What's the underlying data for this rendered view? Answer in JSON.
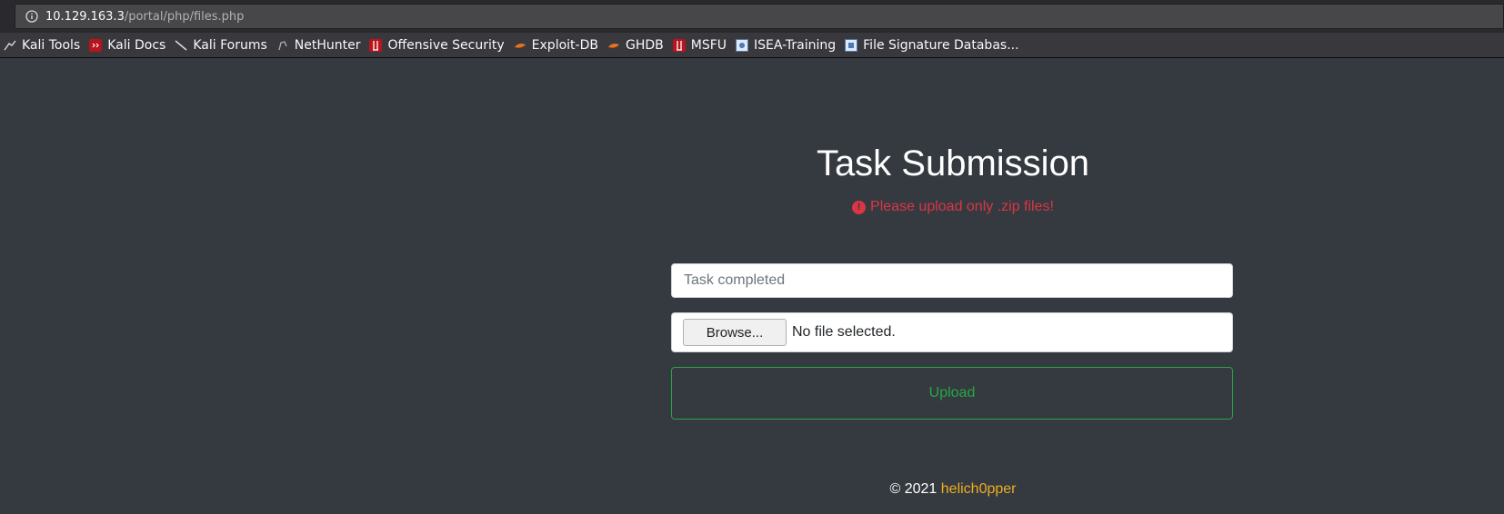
{
  "browser": {
    "url_host": "10.129.163.3",
    "url_path": "/portal/php/files.php",
    "bookmarks": [
      {
        "label": "Kali Tools",
        "icon": "kali-dragon-icon"
      },
      {
        "label": "Kali Docs",
        "icon": "kali-docs-icon"
      },
      {
        "label": "Kali Forums",
        "icon": "kali-dragon-icon"
      },
      {
        "label": "NetHunter",
        "icon": "nethunter-icon"
      },
      {
        "label": "Offensive Security",
        "icon": "offsec-icon"
      },
      {
        "label": "Exploit-DB",
        "icon": "exploit-db-icon"
      },
      {
        "label": "GHDB",
        "icon": "ghdb-icon"
      },
      {
        "label": "MSFU",
        "icon": "offsec-icon"
      },
      {
        "label": "ISEA-Training",
        "icon": "isea-icon"
      },
      {
        "label": "File Signature Databas...",
        "icon": "file-signature-icon"
      }
    ]
  },
  "page": {
    "title": "Task Submission",
    "alert": "Please upload only .zip files!",
    "task_input_placeholder": "Task completed",
    "browse_label": "Browse...",
    "file_status": "No file selected.",
    "upload_label": "Upload",
    "footer_prefix": "© 2021",
    "footer_author": "helich0pper"
  },
  "colors": {
    "background": "#343a40",
    "alert": "#dc3545",
    "upload_accent": "#28a745",
    "author_link": "#f0ad1e"
  }
}
